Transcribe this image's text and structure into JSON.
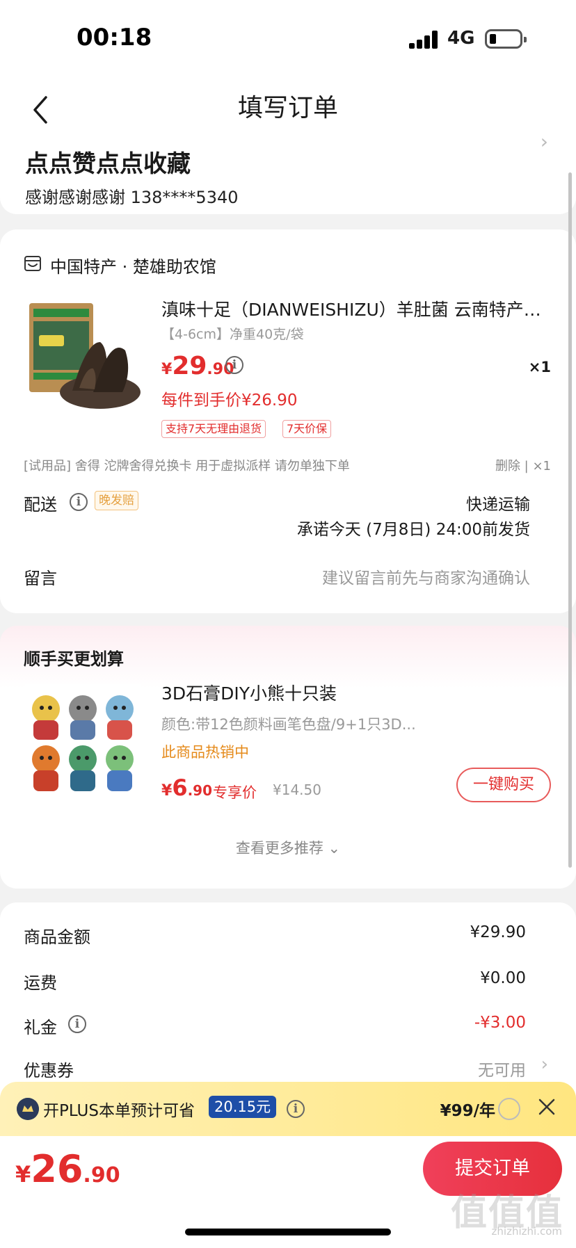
{
  "status_bar": {
    "time": "00:18",
    "network": "4G"
  },
  "nav": {
    "title": "填写订单"
  },
  "address": {
    "name": "点点赞点点收藏",
    "detail": "感谢感谢感谢  138****5340"
  },
  "shop": {
    "name": "中国特产 · 楚雄助农馆"
  },
  "product": {
    "title": "滇味十足（DIANWEISHIZU）羊肚菌 云南特产头...",
    "spec": "【4-6cm】净重40克/袋",
    "price_currency": "¥",
    "price_int": "29",
    "price_dec": ".90",
    "quantity": "×1",
    "final_price": "每件到手价¥26.90",
    "tags": [
      "支持7天无理由退货",
      "7天价保"
    ],
    "info_glyph": "i"
  },
  "gift": {
    "text": "[试用品] 舍得 沱牌舍得兑换卡 用于虚拟派样 请勿单独下单",
    "actions": "删除 | ×1"
  },
  "delivery": {
    "label": "配送",
    "late_tag": "晚发赔",
    "method": "快递运输",
    "promise": "承诺今天 (7月8日) 24:00前发货"
  },
  "message": {
    "label": "留言",
    "placeholder": "建议留言前先与商家沟通确认"
  },
  "recommend": {
    "title": "顺手买更划算",
    "name": "3D石膏DIY小熊十只装",
    "spec": "颜色:带12色颜料画笔色盘/9+1只3D...",
    "hot": "此商品热销中",
    "price_currency": "¥",
    "price_int": "6",
    "price_dec": ".90",
    "vip_label": "专享价",
    "orig_price": "¥14.50",
    "buy_label": "一键购买",
    "more_label": "查看更多推荐 ⌄"
  },
  "summary": {
    "goods_label": "商品金额",
    "goods_value": "¥29.90",
    "freight_label": "运费",
    "freight_value": "¥0.00",
    "gift_label": "礼金",
    "gift_value": "-¥3.00",
    "coupon_label": "优惠券",
    "coupon_value": "无可用"
  },
  "plus": {
    "text": "开PLUS本单预计可省",
    "amount": "20.15元",
    "price": "¥99/年"
  },
  "bottom": {
    "total_currency": "¥",
    "total_int": "26",
    "total_dec": ".90",
    "submit_label": "提交订单",
    "watermark": "值值值",
    "watermark_url": "zhizhizhi.com"
  },
  "colors": {
    "accent_red": "#e22d2d",
    "plus_blue": "#1d4ea8",
    "hot_orange": "#e58a1a"
  }
}
